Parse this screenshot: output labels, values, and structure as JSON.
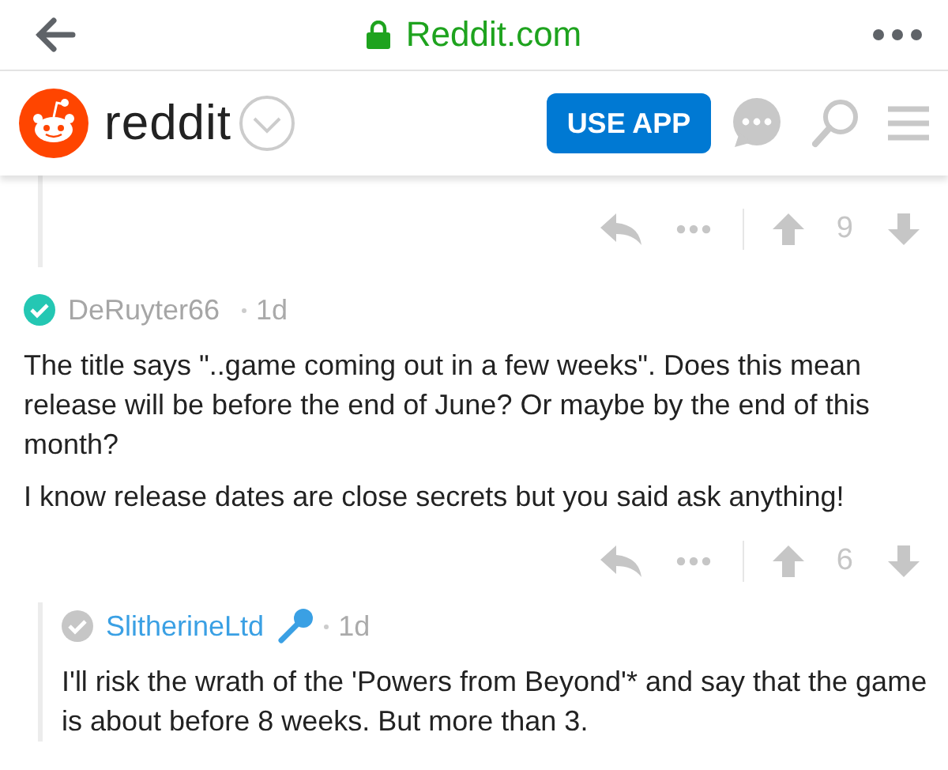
{
  "browser_bar": {
    "url": "Reddit.com"
  },
  "header": {
    "wordmark": "reddit",
    "button": "USE APP"
  },
  "previous_comment": {
    "score": "9"
  },
  "comments": [
    {
      "author": "DeRuyter66",
      "kind": "verified",
      "age": "1d",
      "paragraphs": [
        "The title says \"..game coming out in a few weeks\". Does this mean release will be before the end of June? Or maybe by the end of this month?",
        "I know release dates are close secrets but you said ask anything!"
      ],
      "score": "6",
      "children": [
        {
          "author": "SlitherineLtd",
          "kind": "official",
          "age": "1d",
          "paragraphs": [
            "I'll risk the wrath of the 'Powers from Beyond'* and say that the game is about before 8 weeks. But more than 3."
          ]
        }
      ]
    }
  ]
}
